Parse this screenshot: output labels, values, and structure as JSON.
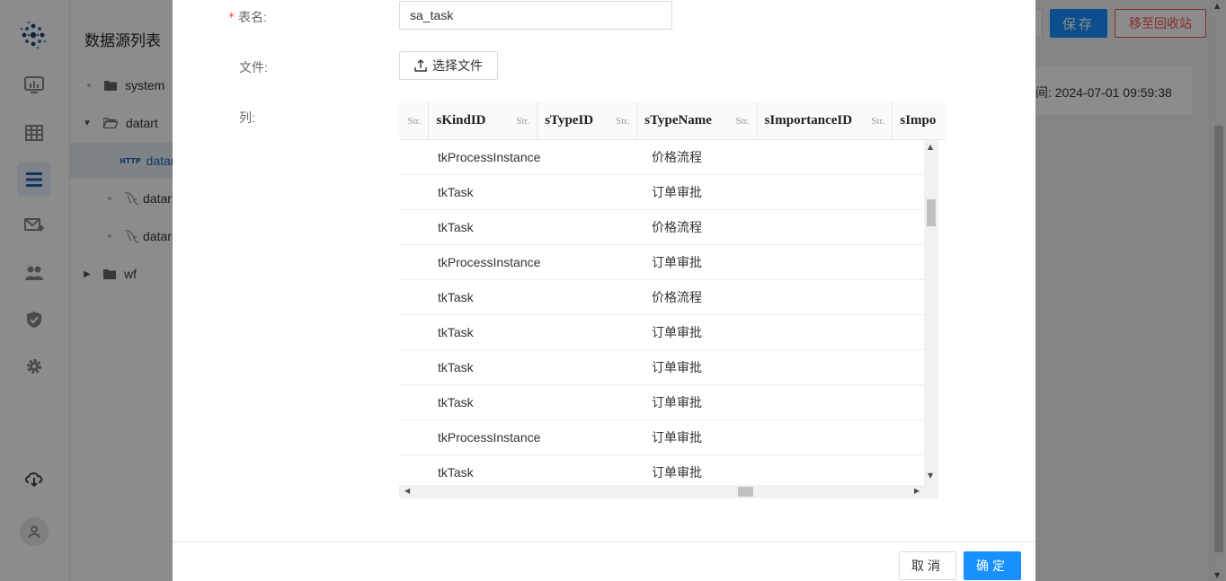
{
  "app": {
    "panel_title": "数据源列表",
    "tree": [
      {
        "label": "system",
        "level": 0,
        "expandable": false,
        "icon": "folder-icon"
      },
      {
        "label": "datart",
        "level": 0,
        "expandable": true,
        "expanded": true,
        "icon": "folder-open-icon"
      },
      {
        "label": "datar",
        "level": 1,
        "icon": "http-icon",
        "selected": true
      },
      {
        "label": "datar",
        "level": 1,
        "icon": "mysql-icon"
      },
      {
        "label": "datar",
        "level": 1,
        "icon": "mysql-icon"
      },
      {
        "label": "wf",
        "level": 0,
        "expandable": true,
        "expanded": false,
        "icon": "folder-icon"
      }
    ],
    "save_label": "保存",
    "recycle_label": "移至回收站",
    "info_text": "间: 2024-07-01 09:59:38"
  },
  "modal": {
    "table_name_label": "表名:",
    "table_name_value": "sa_task",
    "file_label": "文件:",
    "upload_label": "选择文件",
    "columns_label": "列:",
    "cancel_label": "取消",
    "ok_label": "确定"
  },
  "grid": {
    "columns": [
      {
        "name": "",
        "type": "Str."
      },
      {
        "name": "sKindID",
        "type": "Str."
      },
      {
        "name": "sTypeID",
        "type": "Str."
      },
      {
        "name": "sTypeName",
        "type": "Str."
      },
      {
        "name": "sImportanceID",
        "type": "Str."
      },
      {
        "name": "sImpo",
        "type": ""
      }
    ],
    "rows": [
      {
        "kind": "tkProcessInstance",
        "type_name": "价格流程"
      },
      {
        "kind": "tkTask",
        "type_name": "订单审批"
      },
      {
        "kind": "tkTask",
        "type_name": "价格流程"
      },
      {
        "kind": "tkProcessInstance",
        "type_name": "订单审批"
      },
      {
        "kind": "tkTask",
        "type_name": "价格流程"
      },
      {
        "kind": "tkTask",
        "type_name": "订单审批"
      },
      {
        "kind": "tkTask",
        "type_name": "订单审批"
      },
      {
        "kind": "tkTask",
        "type_name": "订单审批"
      },
      {
        "kind": "tkProcessInstance",
        "type_name": "订单审批"
      },
      {
        "kind": "tkTask",
        "type_name": "订单审批"
      }
    ]
  },
  "colors": {
    "primary": "#1890ff",
    "danger": "#ff4d4f",
    "overlay": "rgba(0,0,0,0.45)"
  }
}
